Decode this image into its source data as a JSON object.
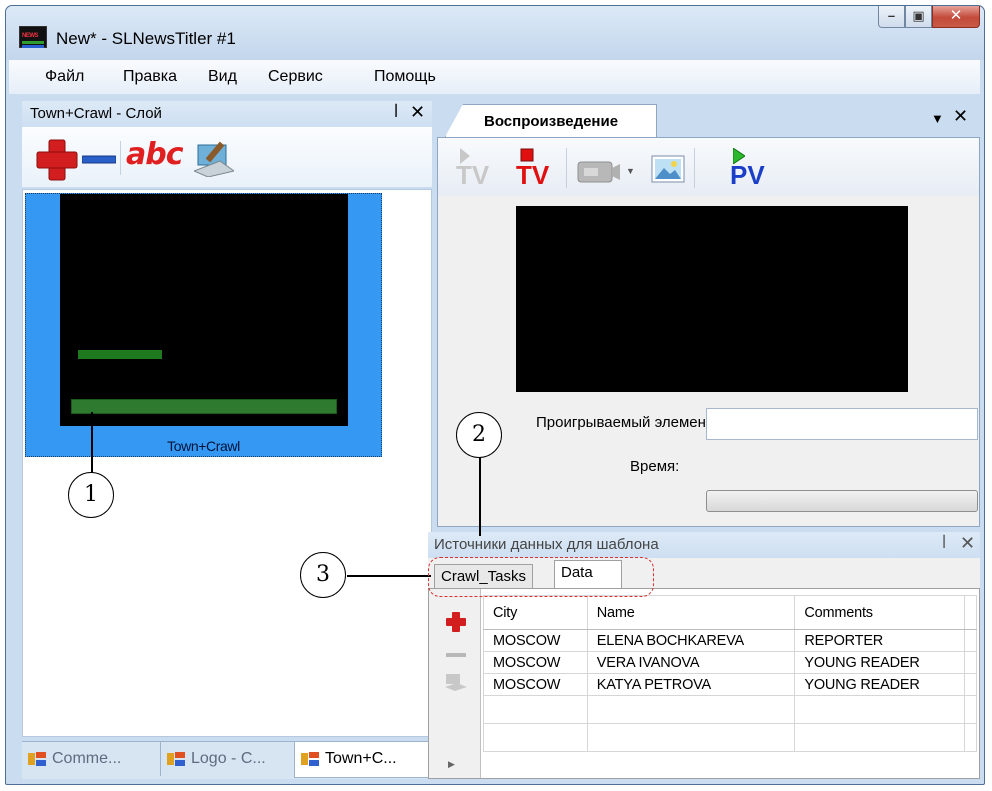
{
  "window": {
    "title": "New* - SLNewsTitler #1",
    "logo_text": "NEWS"
  },
  "menu": [
    "Файл",
    "Правка",
    "Вид",
    "Сервис",
    "Помощь"
  ],
  "layer_panel": {
    "title": "Town+Crawl - Слой",
    "pin_glyph": "ᵖ",
    "toolbar": {
      "text_tool": "abc"
    },
    "thumbnail_label": "Town+Crawl",
    "bottom_tabs": [
      {
        "label": "Comme...",
        "active": false
      },
      {
        "label": "Logo - C...",
        "active": false
      },
      {
        "label": "Town+C...",
        "active": true
      }
    ]
  },
  "playback_panel": {
    "tab_label": "Воспроизведение",
    "toolbar": {
      "tv_prev": "TV",
      "tv_play": "TV",
      "pv": "PV"
    },
    "playing_element_label": "Проигрываемый элемент:",
    "playing_element_value": "",
    "time_label": "Время:"
  },
  "data_sources_panel": {
    "title": "Источники данных для шаблона",
    "tabs": [
      {
        "label": "Crawl_Tasks",
        "active": false
      },
      {
        "label": "Data",
        "active": true
      }
    ],
    "columns": [
      "City",
      "Name",
      "Comments"
    ],
    "rows": [
      [
        "MOSCOW",
        "ELENA BOCHKAREVA",
        "REPORTER"
      ],
      [
        "MOSCOW",
        "VERA IVANOVA",
        "YOUNG READER"
      ],
      [
        "MOSCOW",
        "KATYA PETROVA",
        "YOUNG READER"
      ]
    ]
  },
  "callouts": [
    "1",
    "2",
    "3"
  ],
  "colors": {
    "accent_selection": "#3598f2",
    "crawl_bar": "#2e7a2e",
    "callout_dash": "#d83030"
  }
}
